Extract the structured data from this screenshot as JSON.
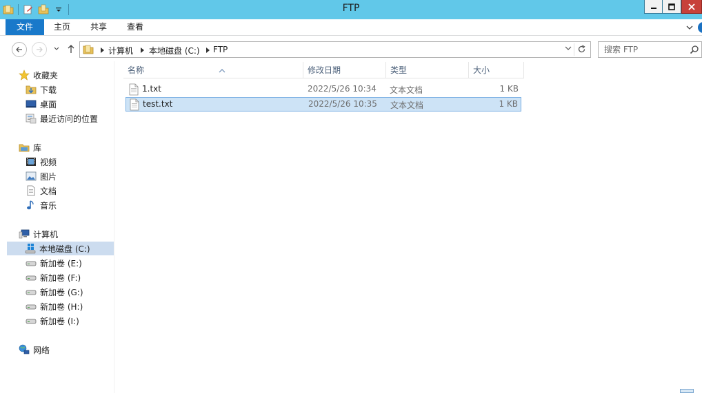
{
  "window": {
    "title": "FTP"
  },
  "ribbon": {
    "tabs": [
      {
        "label": "文件"
      },
      {
        "label": "主页"
      },
      {
        "label": "共享"
      },
      {
        "label": "查看"
      }
    ]
  },
  "address": {
    "crumbs": [
      "计算机",
      "本地磁盘 (C:)",
      "FTP"
    ]
  },
  "search": {
    "placeholder": "搜索 FTP"
  },
  "sidebar": {
    "favorites": {
      "label": "收藏夹",
      "items": [
        "下载",
        "桌面",
        "最近访问的位置"
      ]
    },
    "libraries": {
      "label": "库",
      "items": [
        "视频",
        "图片",
        "文档",
        "音乐"
      ]
    },
    "computer": {
      "label": "计算机",
      "items": [
        "本地磁盘 (C:)",
        "新加卷 (E:)",
        "新加卷 (F:)",
        "新加卷 (G:)",
        "新加卷 (H:)",
        "新加卷 (I:)"
      ]
    },
    "network": {
      "label": "网络"
    }
  },
  "filelist": {
    "columns": {
      "name": "名称",
      "date": "修改日期",
      "type": "类型",
      "size": "大小"
    },
    "rows": [
      {
        "name": "1.txt",
        "date": "2022/5/26 10:34",
        "type": "文本文档",
        "size": "1 KB"
      },
      {
        "name": "test.txt",
        "date": "2022/5/26 10:35",
        "type": "文本文档",
        "size": "1 KB"
      }
    ],
    "selected_row": 1
  },
  "colors": {
    "titlebar": "#61c8e9",
    "file_tab": "#1979ca",
    "close_button": "#c7413a",
    "selection": "#cde3f6"
  }
}
